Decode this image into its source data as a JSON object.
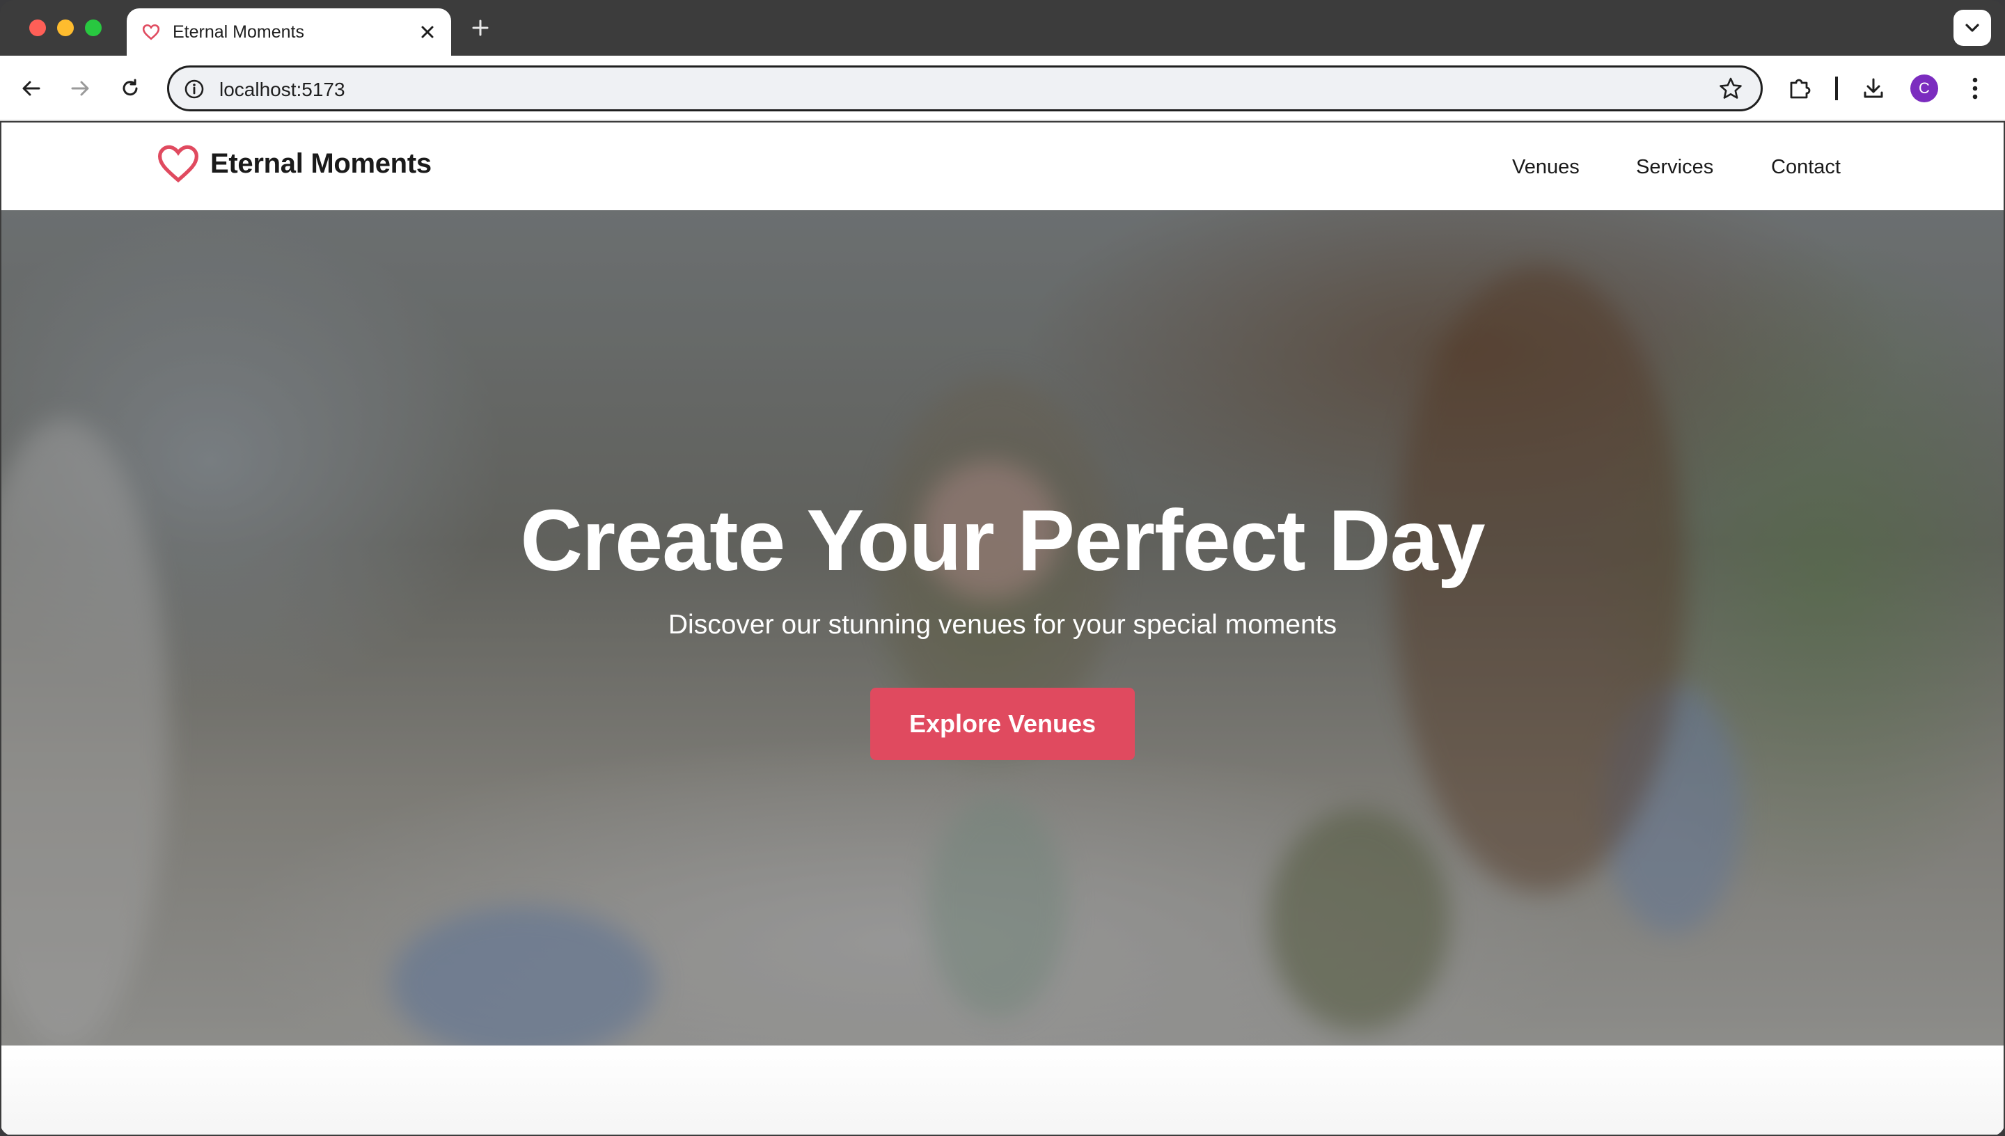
{
  "browser": {
    "tab_title": "Eternal Moments",
    "url": "localhost:5173",
    "profile_initial": "C"
  },
  "site": {
    "brand_name": "Eternal Moments",
    "brand_color": "#e04a5f",
    "nav": [
      "Venues",
      "Services",
      "Contact"
    ]
  },
  "hero": {
    "title": "Create Your Perfect Day",
    "subtitle": "Discover our stunning venues for your special moments",
    "cta_label": "Explore Venues"
  }
}
